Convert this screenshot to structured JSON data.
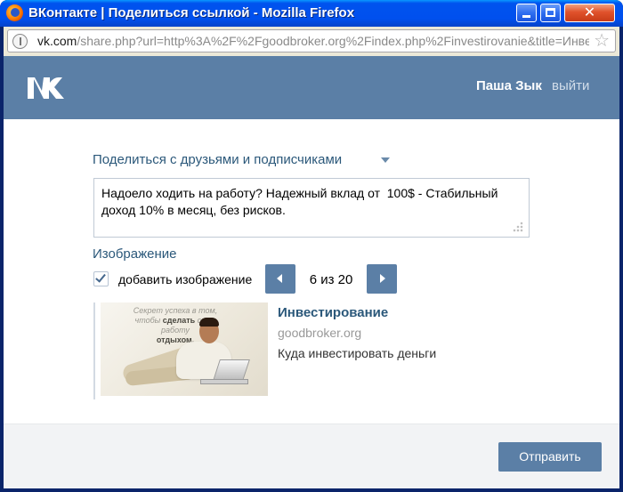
{
  "window": {
    "title": "ВКонтакте | Поделиться ссылкой - Mozilla Firefox",
    "minimize_label": "",
    "close_label": "✕"
  },
  "address_bar": {
    "host": "vk.com",
    "path": "/share.php?url=http%3A%2F%2Fgoodbroker.org%2Findex.php%2Finvestirovanie&title=Инве"
  },
  "header": {
    "user_name": "Паша Зык",
    "logout": "выйти"
  },
  "share": {
    "target": "Поделиться с друзьями и подписчиками",
    "message": "Надоело ходить на работу? Надежный вклад от  100$ - Стабильный\nдоход 10% в месяц, без рисков.",
    "image_heading": "Изображение",
    "add_image_label": "добавить изображение",
    "add_image_checked": true,
    "counter": "6 из 20"
  },
  "preview": {
    "slogan_line1": "Секрет успеха в том,",
    "slogan_line2a": "чтобы ",
    "slogan_bold": "сделать",
    "slogan_line2b": " свою",
    "slogan_line3": "работу",
    "slogan_line4": "отдыхом.",
    "title": "Инвестирование",
    "domain": "goodbroker.org",
    "description": "Куда инвестировать деньги"
  },
  "footer": {
    "send_label": "Отправить"
  },
  "colors": {
    "vk_blue": "#5b7fa6",
    "link_blue": "#2b587a",
    "xp_title_blue": "#0053ee"
  }
}
